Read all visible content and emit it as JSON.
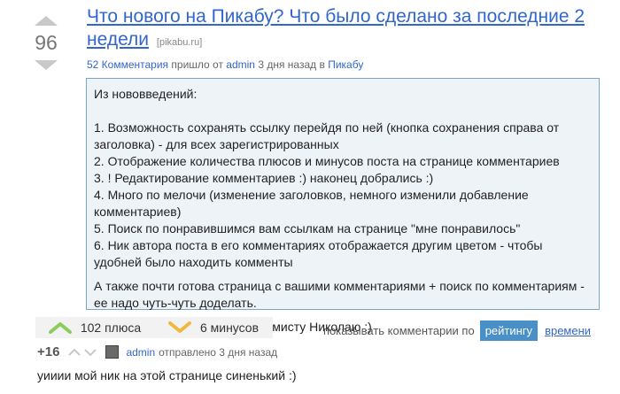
{
  "post": {
    "score": "96",
    "title": "Что нового на Пикабу? Что было сделано за последние 2 недели",
    "domain": "[pikabu.ru]",
    "meta": {
      "comments_link": "52 Комментария",
      "sent_text": " пришло от ",
      "author": "admin",
      "time_text": " 3 дня назад в ",
      "community": "Пикабу"
    },
    "content": {
      "intro": "Из нововведений:",
      "items": [
        "1. Возможность сохранять ссылку перейдя по ней (кнопка сохранения справа от заголовка) - для всех зарегистрированных",
        "2. Отображение количества плюсов и минусов поста на странице комментариев",
        "3. ! Редактирование комментариев :) наконец добрались :)",
        "4. Много по мелочи (изменение заголовков, немного изменили добавление комментариев)",
        "5. Поиск по понравившимся вам ссылкам на странице \"мне понравилось\"",
        "6. Ник автора поста в его комментариях отображается другим цветом - чтобы удобней было находить комменты"
      ],
      "also": "А также почти готова страница с вашими комментариями + поиск по комментариям - ее надо чуть-чуть доделать.",
      "thanks": "Все респекты нашему программисту Николаю :)"
    },
    "stats": {
      "plus_label": "102 плюса",
      "minus_label": "6 минусов"
    }
  },
  "sort": {
    "label": "показывать комментарии по",
    "rating": "рейтингу",
    "time": "времени"
  },
  "comment": {
    "score": "+16",
    "author": "admin",
    "time": "отправлено 3 дня назад",
    "text": "уииии мой ник на этой странице синенький :)"
  },
  "colors": {
    "link": "#3366cc",
    "box_bg": "#eef3f8",
    "box_border": "#7aa6c8",
    "plus_icon": "#8dcc5a",
    "minus_icon": "#f0b840",
    "sort_active": "#4a90c8"
  },
  "icons": {
    "vote_up": "upvote-arrow-icon",
    "vote_down": "downvote-arrow-icon",
    "plus": "plus-chevron-icon",
    "minus": "minus-chevron-icon"
  }
}
